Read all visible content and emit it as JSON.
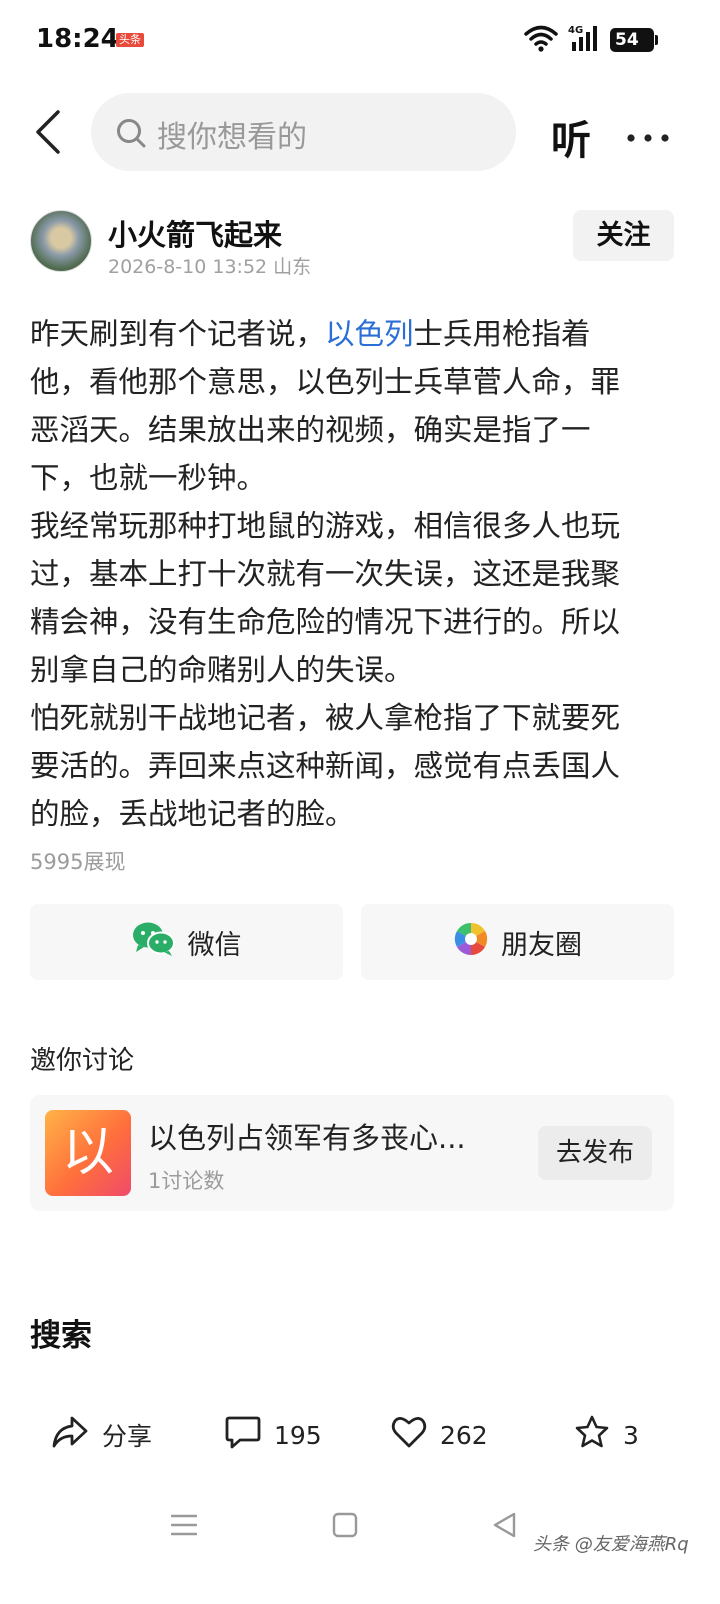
{
  "status_bar": {
    "time": "18:24",
    "app_badge": "头条",
    "network": "4G",
    "battery": "54"
  },
  "top_nav": {
    "search_placeholder": "搜你想看的",
    "listen_label": "听"
  },
  "author": {
    "name": "小火箭飞起来",
    "meta": "2026-8-10 13:52 山东",
    "follow_label": "关注"
  },
  "post": {
    "link_text": "以色列",
    "lines": [
      "昨天刷到有个记者说，",
      "士兵用枪指着",
      "他，看他那个意思，以色列士兵草菅人命，罪",
      "恶滔天。结果放出来的视频，确实是指了一",
      "下，也就一秒钟。",
      "我经常玩那种打地鼠的游戏，相信很多人也玩",
      "过，基本上打十次就有一次失误，这还是我聚",
      "精会神，没有生命危险的情况下进行的。所以",
      "别拿自己的命赌别人的失误。",
      "怕死就别干战地记者，被人拿枪指了下就要死",
      "要活的。弄回来点这种新闻，感觉有点丢国人",
      "的脸，丢战地记者的脸。"
    ],
    "view_count": "5995展现"
  },
  "share": {
    "wechat_label": "微信",
    "moments_label": "朋友圈"
  },
  "discussion": {
    "title": "邀你讨论",
    "thumb_char": "以",
    "topic": "以色列占领军有多丧心...",
    "count": "1讨论数",
    "publish_label": "去发布"
  },
  "search_section_title": "搜索",
  "actions": {
    "share_label": "分享",
    "comment_count": "195",
    "like_count": "262",
    "favorite_count": "3"
  },
  "watermark": "头条 @友爱海燕Rq",
  "colors": {
    "link": "#2b6fd6",
    "wechat_green": "#2aae67"
  }
}
